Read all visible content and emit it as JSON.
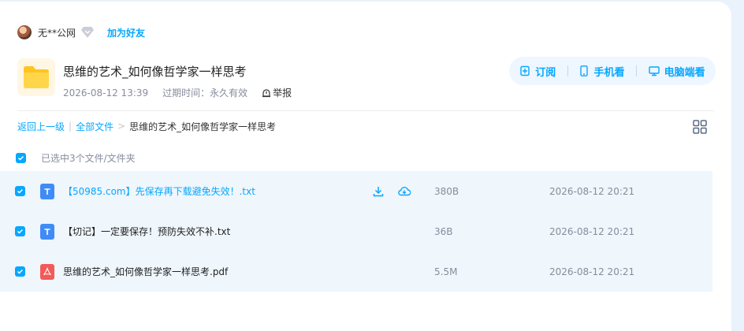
{
  "user": {
    "name": "无**公网",
    "add_friend": "加为好友"
  },
  "folder": {
    "title": "思维的艺术_如何像哲学家一样思考",
    "date": "2026-08-12 13:39",
    "expire": "过期时间：永久有效",
    "report": "举报"
  },
  "actions": {
    "subscribe": "订阅",
    "mobile": "手机看",
    "pc": "电脑端看"
  },
  "breadcrumb": {
    "back": "返回上一级",
    "all": "全部文件",
    "sep": ">",
    "current": "思维的艺术_如何像哲学家一样思考"
  },
  "selection": {
    "text": "已选中3个文件/文件夹"
  },
  "files": [
    {
      "name": "【50985.com】先保存再下载避免失效！.txt",
      "size": "380B",
      "date": "2026-08-12 20:21",
      "type": "txt"
    },
    {
      "name": "【切记】一定要保存！预防失效不补.txt",
      "size": "36B",
      "date": "2026-08-12 20:21",
      "type": "txt"
    },
    {
      "name": "思维的艺术_如何像哲学家一样思考.pdf",
      "size": "5.5M",
      "date": "2026-08-12 20:21",
      "type": "pdf"
    }
  ],
  "colors": {
    "accent": "#06a7ff",
    "row_bg": "#eff6fc",
    "pdf": "#f25a5a",
    "txt": "#3f8cf7"
  }
}
